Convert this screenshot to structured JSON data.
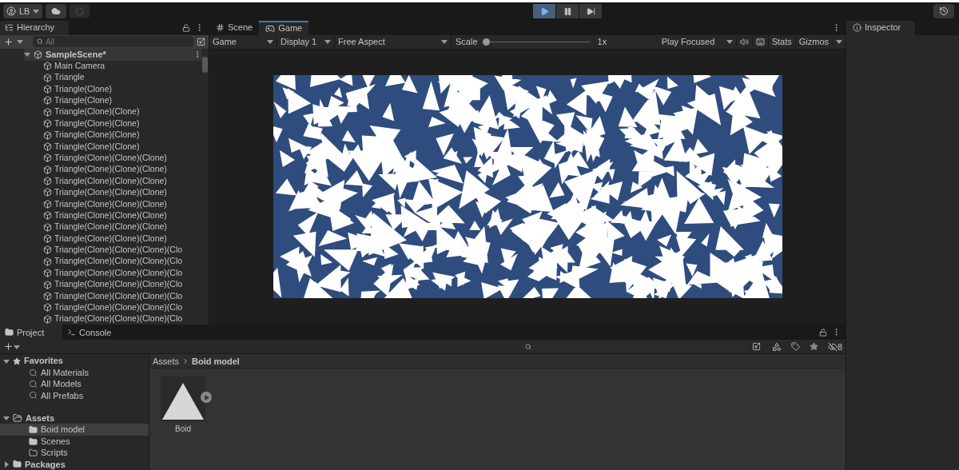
{
  "toolbar": {
    "account": "LB",
    "controls": [
      {
        "kind": "play",
        "selected": true
      },
      {
        "kind": "pause",
        "selected": false
      },
      {
        "kind": "step",
        "selected": false
      }
    ]
  },
  "hierarchy": {
    "title": "Hierarchy",
    "search": {
      "placeholder": "All"
    },
    "scene": {
      "name": "SampleScene*",
      "expanded": true
    },
    "items": [
      "Main Camera",
      "Triangle",
      "Triangle(Clone)",
      "Triangle(Clone)",
      "Triangle(Clone)(Clone)",
      "Triangle(Clone)(Clone)",
      "Triangle(Clone)(Clone)",
      "Triangle(Clone)(Clone)",
      "Triangle(Clone)(Clone)(Clone)",
      "Triangle(Clone)(Clone)(Clone)",
      "Triangle(Clone)(Clone)(Clone)",
      "Triangle(Clone)(Clone)(Clone)",
      "Triangle(Clone)(Clone)(Clone)",
      "Triangle(Clone)(Clone)(Clone)",
      "Triangle(Clone)(Clone)(Clone)",
      "Triangle(Clone)(Clone)(Clone)",
      "Triangle(Clone)(Clone)(Clone)(Clo",
      "Triangle(Clone)(Clone)(Clone)(Clo",
      "Triangle(Clone)(Clone)(Clone)(Clo",
      "Triangle(Clone)(Clone)(Clone)(Clo",
      "Triangle(Clone)(Clone)(Clone)(Clo",
      "Triangle(Clone)(Clone)(Clone)(Clo",
      "Triangle(Clone)(Clone)(Clone)(Clo"
    ]
  },
  "view": {
    "tabs": [
      {
        "label": "Scene",
        "kind": "scene",
        "selected": false
      },
      {
        "label": "Game",
        "kind": "game",
        "selected": true
      }
    ],
    "toolbar": {
      "mode": "Game",
      "display": "Display 1",
      "aspect": "Free Aspect",
      "scale_label": "Scale",
      "scale": {
        "level": 0
      },
      "scale_reading": "1x",
      "play_mode": "Play Focused",
      "stats": "Stats",
      "gizmos": "Gizmos"
    }
  },
  "inspector": {
    "title": "Inspector"
  },
  "project": {
    "tabs": [
      {
        "label": "Project",
        "kind": "project",
        "selected": true
      },
      {
        "label": "Console",
        "kind": "console",
        "selected": false
      }
    ],
    "tree": [
      {
        "label": "Favorites",
        "kind": "favorites",
        "expanded": true,
        "children": [
          {
            "label": "All Materials",
            "kind": "search",
            "selected": false
          },
          {
            "label": "All Models",
            "kind": "search",
            "selected": false
          },
          {
            "label": "All Prefabs",
            "kind": "search",
            "selected": false
          }
        ]
      },
      {
        "label": "Assets",
        "kind": "folder",
        "expanded": true,
        "children": [
          {
            "label": "Boid model",
            "kind": "folder",
            "selected": true
          },
          {
            "label": "Scenes",
            "kind": "folder",
            "selected": false
          },
          {
            "label": "Scripts",
            "kind": "empty_folder",
            "selected": false
          }
        ]
      },
      {
        "label": "Packages",
        "kind": "folder",
        "expanded": false
      }
    ],
    "breadcrumb": [
      "Assets",
      "Boid model"
    ],
    "assets": [
      {
        "name": "Boid"
      }
    ],
    "hidden_count": "8"
  }
}
